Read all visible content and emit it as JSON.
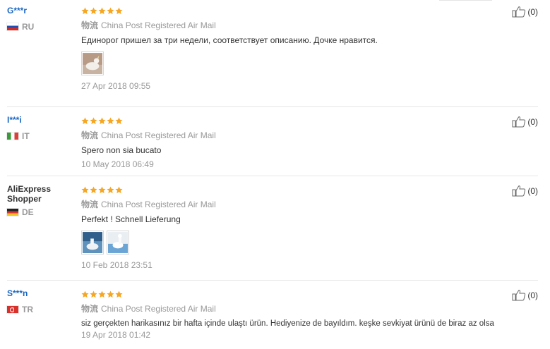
{
  "reviews": [
    {
      "user": "G***r",
      "user_is_link": true,
      "country": "RU",
      "rating": 5,
      "logistics_label": "物流",
      "logistics": "China Post Registered Air Mail",
      "text": "Единорог пришел за три недели, соответствует описанию. Дочке нравится.",
      "images": [
        {
          "name": "review-photo-unicorn-float"
        }
      ],
      "date": "27 Apr 2018 09:55",
      "useful": "(0)"
    },
    {
      "user": "I***i",
      "user_is_link": true,
      "country": "IT",
      "rating": 5,
      "logistics_label": "物流",
      "logistics": "China Post Registered Air Mail",
      "text": "Spero non sia bucato",
      "images": [],
      "date": "10 May 2018 06:49",
      "useful": "(0)"
    },
    {
      "user": "AliExpress Shopper",
      "user_is_link": false,
      "country": "DE",
      "rating": 5,
      "logistics_label": "物流",
      "logistics": "China Post Registered Air Mail",
      "text": "Perfekt ! Schnell Lieferung",
      "images": [
        {
          "name": "review-photo-pool-1"
        },
        {
          "name": "review-photo-pool-2"
        }
      ],
      "date": "10 Feb 2018 23:51",
      "useful": "(0)"
    },
    {
      "user": "S***n",
      "user_is_link": true,
      "country": "TR",
      "rating": 5,
      "logistics_label": "物流",
      "logistics": "China Post Registered Air Mail",
      "text": "siz gerçekten harikasınız bir hafta içinde ulaştı ürün. Hediyenize de bayıldım. keşke sevkiyat ürünü de biraz az olsa",
      "images": [],
      "date": "19 Apr 2018 01:42",
      "useful": "(0)"
    }
  ],
  "colors": {
    "star": "#f5a623",
    "link": "#1a66c4",
    "muted": "#999999"
  },
  "icons": {
    "rating": "star-icon",
    "useful": "thumbs-up-icon"
  }
}
